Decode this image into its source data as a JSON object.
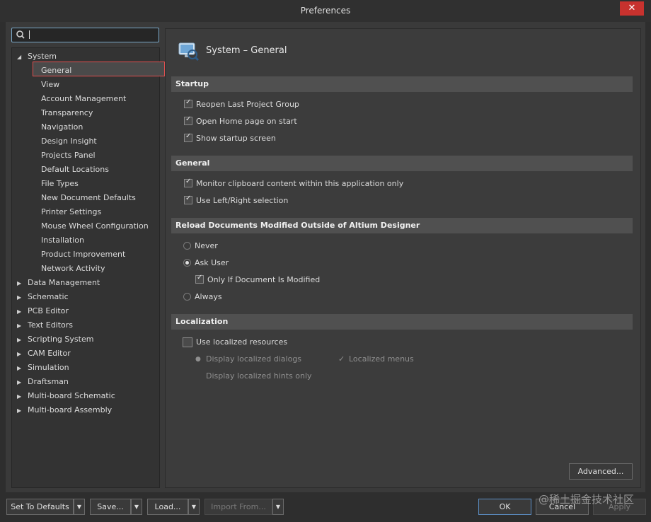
{
  "window": {
    "title": "Preferences",
    "close_glyph": "✕"
  },
  "search": {
    "value": ""
  },
  "tree": {
    "root_label": "System",
    "children": [
      "General",
      "View",
      "Account Management",
      "Transparency",
      "Navigation",
      "Design Insight",
      "Projects Panel",
      "Default Locations",
      "File Types",
      "New Document Defaults",
      "Printer Settings",
      "Mouse Wheel Configuration",
      "Installation",
      "Product Improvement",
      "Network Activity"
    ],
    "collapsed": [
      "Data Management",
      "Schematic",
      "PCB Editor",
      "Text Editors",
      "Scripting System",
      "CAM Editor",
      "Simulation",
      "Draftsman",
      "Multi-board Schematic",
      "Multi-board Assembly"
    ],
    "selected": "General"
  },
  "page": {
    "title": "System – General"
  },
  "sections": {
    "startup": {
      "label": "Startup",
      "options": [
        {
          "label": "Reopen Last Project Group",
          "checked": true
        },
        {
          "label": "Open Home page on start",
          "checked": true
        },
        {
          "label": "Show startup screen",
          "checked": true
        }
      ]
    },
    "general": {
      "label": "General",
      "options": [
        {
          "label": "Monitor clipboard content within this application only",
          "checked": true
        },
        {
          "label": "Use Left/Right selection",
          "checked": true
        }
      ]
    },
    "reload": {
      "label": "Reload Documents Modified Outside of Altium Designer",
      "never": "Never",
      "ask": "Ask User",
      "only_if": "Only If Document Is Modified",
      "always": "Always",
      "selected": "Ask User"
    },
    "localization": {
      "label": "Localization",
      "use": "Use localized resources",
      "dialogs": "Display localized dialogs",
      "menus": "Localized menus",
      "hints": "Display localized hints only"
    }
  },
  "buttons": {
    "advanced": "Advanced...",
    "set_defaults": "Set To Defaults",
    "save": "Save...",
    "load": "Load...",
    "import": "Import From...",
    "ok": "OK",
    "cancel": "Cancel",
    "apply": "Apply"
  },
  "watermark": "@稀土掘金技术社区",
  "colors": {
    "accent": "#5b8ec4",
    "close": "#c8322e",
    "selection_outline": "#e05050"
  }
}
